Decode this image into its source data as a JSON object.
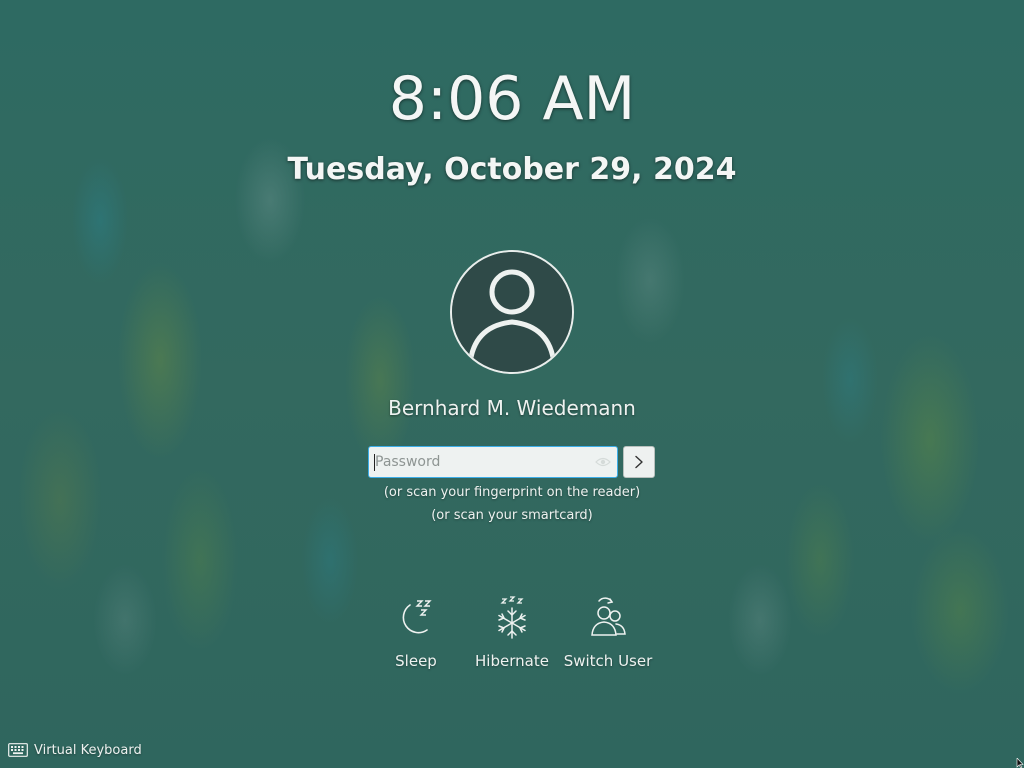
{
  "clock": {
    "time": "8:06 AM",
    "date": "Tuesday, October 29, 2024"
  },
  "user": {
    "name": "Bernhard M. Wiedemann",
    "avatar_icon": "user-silhouette-icon"
  },
  "login": {
    "password_placeholder": "Password",
    "password_value": "",
    "submit_icon": "chevron-right-icon",
    "reveal_icon": "eye-icon",
    "hint_fingerprint": "(or scan your fingerprint on the reader)",
    "hint_smartcard": "(or scan your smartcard)"
  },
  "actions": [
    {
      "label": "Sleep",
      "icon": "moon-sleep-icon"
    },
    {
      "label": "Hibernate",
      "icon": "snowflake-hibernate-icon"
    },
    {
      "label": "Switch User",
      "icon": "switch-user-icon"
    }
  ],
  "footer": {
    "virtual_keyboard_label": "Virtual Keyboard",
    "virtual_keyboard_icon": "keyboard-icon"
  },
  "colors": {
    "background": "#2f6b63",
    "input_focus_border": "#3daee9",
    "text": "#f2f4f3"
  }
}
